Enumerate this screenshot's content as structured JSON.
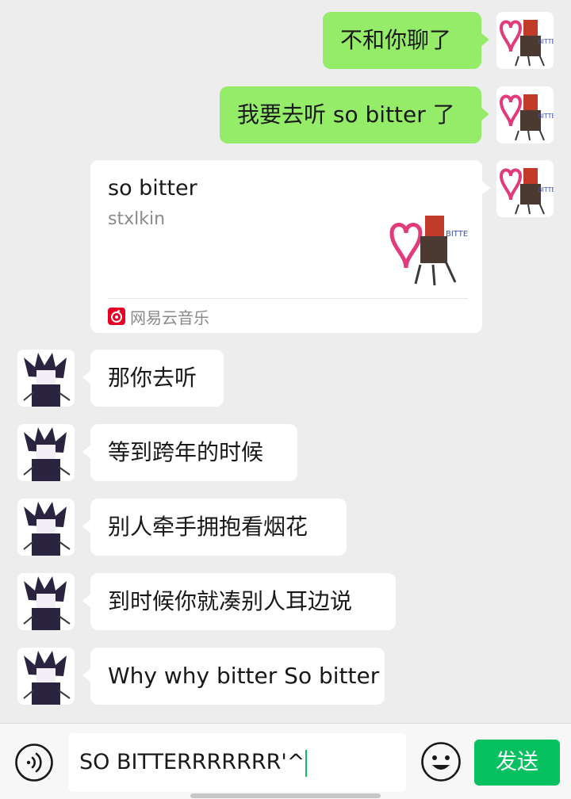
{
  "colors": {
    "background": "#ededed",
    "outgoing_bubble": "#95ec69",
    "incoming_bubble": "#ffffff",
    "send_button": "#07c160",
    "netease_red": "#e60026"
  },
  "outgoing": [
    {
      "text": "不和你聊了"
    },
    {
      "text": "我要去听 so bitter 了"
    }
  ],
  "music_card": {
    "title": "so bitter",
    "artist": "stxlkin",
    "source": "网易云音乐",
    "cover_text": "BITTER"
  },
  "avatar_text": "BITTER",
  "incoming": [
    {
      "text": "那你去听"
    },
    {
      "text": "等到跨年的时候"
    },
    {
      "text": "别人牵手拥抱看烟花"
    },
    {
      "text": "到时候你就凑别人耳边说"
    },
    {
      "text": "Why why bitter So bitter"
    }
  ],
  "input": {
    "value": "SO BITTERRRRRRR'^",
    "send_label": "发送"
  },
  "icons": {
    "voice": "voice-icon",
    "emoji": "emoji-icon",
    "netease": "netease-music-icon"
  }
}
